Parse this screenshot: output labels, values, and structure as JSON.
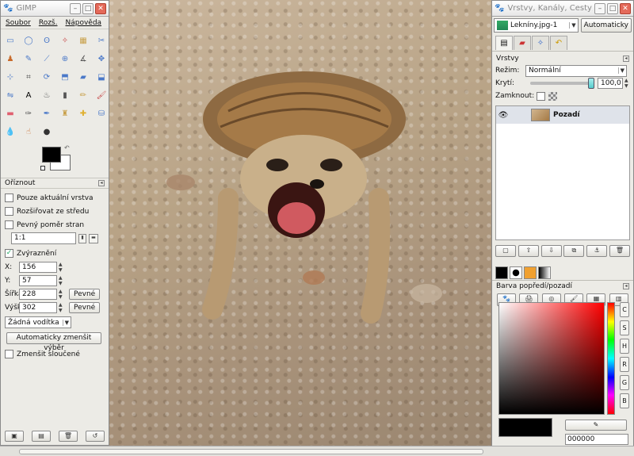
{
  "toolbox": {
    "title": "GIMP",
    "menu": [
      "Soubor",
      "Rozš.",
      "Nápověda"
    ],
    "tools": [
      {
        "name": "rect-select-icon",
        "glyph": "▭",
        "color": "#4a78c8"
      },
      {
        "name": "ellipse-select-icon",
        "glyph": "◯",
        "color": "#4a78c8"
      },
      {
        "name": "free-select-icon",
        "glyph": "ʘ",
        "color": "#4a78c8"
      },
      {
        "name": "fuzzy-select-icon",
        "glyph": "✧",
        "color": "#c84a4a"
      },
      {
        "name": "select-by-color-icon",
        "glyph": "▦",
        "color": "#c8a04a"
      },
      {
        "name": "scissors-icon",
        "glyph": "✂",
        "color": "#4a78c8"
      },
      {
        "name": "foreground-select-icon",
        "glyph": "♟",
        "color": "#c86a2a"
      },
      {
        "name": "paths-icon",
        "glyph": "✎",
        "color": "#4a78c8"
      },
      {
        "name": "color-picker-icon",
        "glyph": "⟋",
        "color": "#4a78c8"
      },
      {
        "name": "zoom-icon",
        "glyph": "⊕",
        "color": "#4a78c8"
      },
      {
        "name": "measure-icon",
        "glyph": "∡",
        "color": "#555555"
      },
      {
        "name": "move-icon",
        "glyph": "✥",
        "color": "#4a78c8"
      },
      {
        "name": "align-icon",
        "glyph": "⊹",
        "color": "#4a78c8"
      },
      {
        "name": "crop-icon",
        "glyph": "⌗",
        "color": "#555555"
      },
      {
        "name": "rotate-icon",
        "glyph": "⟳",
        "color": "#4a78c8"
      },
      {
        "name": "scale-icon",
        "glyph": "⬒",
        "color": "#4a78c8"
      },
      {
        "name": "shear-icon",
        "glyph": "▰",
        "color": "#4a78c8"
      },
      {
        "name": "perspective-icon",
        "glyph": "⬓",
        "color": "#4a78c8"
      },
      {
        "name": "flip-icon",
        "glyph": "⇋",
        "color": "#4a78c8"
      },
      {
        "name": "text-icon",
        "glyph": "A",
        "color": "#000000"
      },
      {
        "name": "bucket-fill-icon",
        "glyph": "♨",
        "color": "#555555"
      },
      {
        "name": "blend-icon",
        "glyph": "▮",
        "color": "#555555"
      },
      {
        "name": "pencil-icon",
        "glyph": "✏",
        "color": "#c8a04a"
      },
      {
        "name": "paintbrush-icon",
        "glyph": "🖌",
        "color": "#c84a4a"
      },
      {
        "name": "eraser-icon",
        "glyph": "▬",
        "color": "#e06070"
      },
      {
        "name": "airbrush-icon",
        "glyph": "✑",
        "color": "#555555"
      },
      {
        "name": "ink-icon",
        "glyph": "✒",
        "color": "#4a78c8"
      },
      {
        "name": "clone-icon",
        "glyph": "♜",
        "color": "#c8a04a"
      },
      {
        "name": "heal-icon",
        "glyph": "✚",
        "color": "#e0b030"
      },
      {
        "name": "perspective-clone-icon",
        "glyph": "⛁",
        "color": "#4a78c8"
      },
      {
        "name": "blur-icon",
        "glyph": "💧",
        "color": "#4a78c8"
      },
      {
        "name": "smudge-icon",
        "glyph": "☝",
        "color": "#c86a2a"
      },
      {
        "name": "dodge-burn-icon",
        "glyph": "●",
        "color": "#333333"
      }
    ],
    "options_title": "Oříznout",
    "opt_current_layer": "Pouze aktuální vrstva",
    "opt_expand_center": "Rozšiřovat ze středu",
    "opt_fixed_ratio": "Pevný poměr stran",
    "ratio_value": "1:1",
    "opt_highlight": "Zvýraznění",
    "x_label": "X:",
    "x_value": "156",
    "y_label": "Y:",
    "y_value": "57",
    "w_label": "Šířka:",
    "w_value": "228",
    "h_label": "Výška:",
    "h_value": "302",
    "fixed_btn": "Pevné",
    "guides": "Žádná vodítka",
    "auto_shrink": "Automaticky zmenšit výběr",
    "shrink_merged": "Zmenšit sloučené"
  },
  "dock": {
    "title": "Vrstvy, Kanály, Cesty, ...",
    "image_name": "Lekníny.jpg-1",
    "auto_btn": "Automaticky",
    "layers_title": "Vrstvy",
    "mode_label": "Režim:",
    "mode_value": "Normální",
    "opacity_label": "Krytí:",
    "opacity_value": "100,0",
    "lock_label": "Zamknout:",
    "layer_name": "Pozadí",
    "colors_title": "Barva popředí/pozadí",
    "channels": [
      "C",
      "S",
      "H",
      "R",
      "G",
      "B"
    ],
    "hex_value": "000000"
  }
}
